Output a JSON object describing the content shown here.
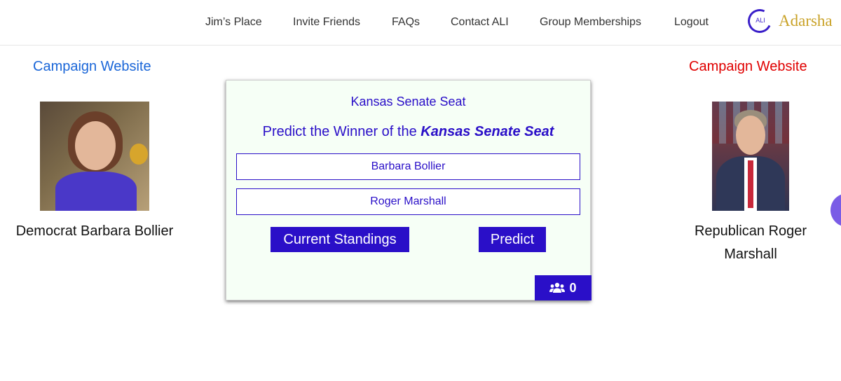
{
  "nav": {
    "items": [
      "Jim’s Place",
      "Invite Friends",
      "FAQs",
      "Contact ALI",
      "Group Memberships",
      "Logout"
    ],
    "logo_mark": "ALI",
    "logo_text": "Adarsha"
  },
  "left_candidate": {
    "campaign_link": "Campaign Website",
    "name": "Democrat Barbara Bollier"
  },
  "right_candidate": {
    "campaign_link": "Campaign Website",
    "name": "Republican Roger Marshall"
  },
  "card": {
    "title": "Kansas Senate Seat",
    "prompt_prefix": "Predict the Winner of the ",
    "prompt_emphasis": "Kansas Senate Seat",
    "options": [
      "Barbara Bollier",
      "Roger Marshall"
    ],
    "standings_button": "Current Standings",
    "predict_button": "Predict",
    "participant_icon": "users-icon",
    "participant_count": "0"
  },
  "colors": {
    "accent": "#2a0fc8",
    "left_link": "#1a66d8",
    "right_link": "#e00000",
    "logo_gold": "#c9a227",
    "card_bg": "#f6fff6"
  }
}
